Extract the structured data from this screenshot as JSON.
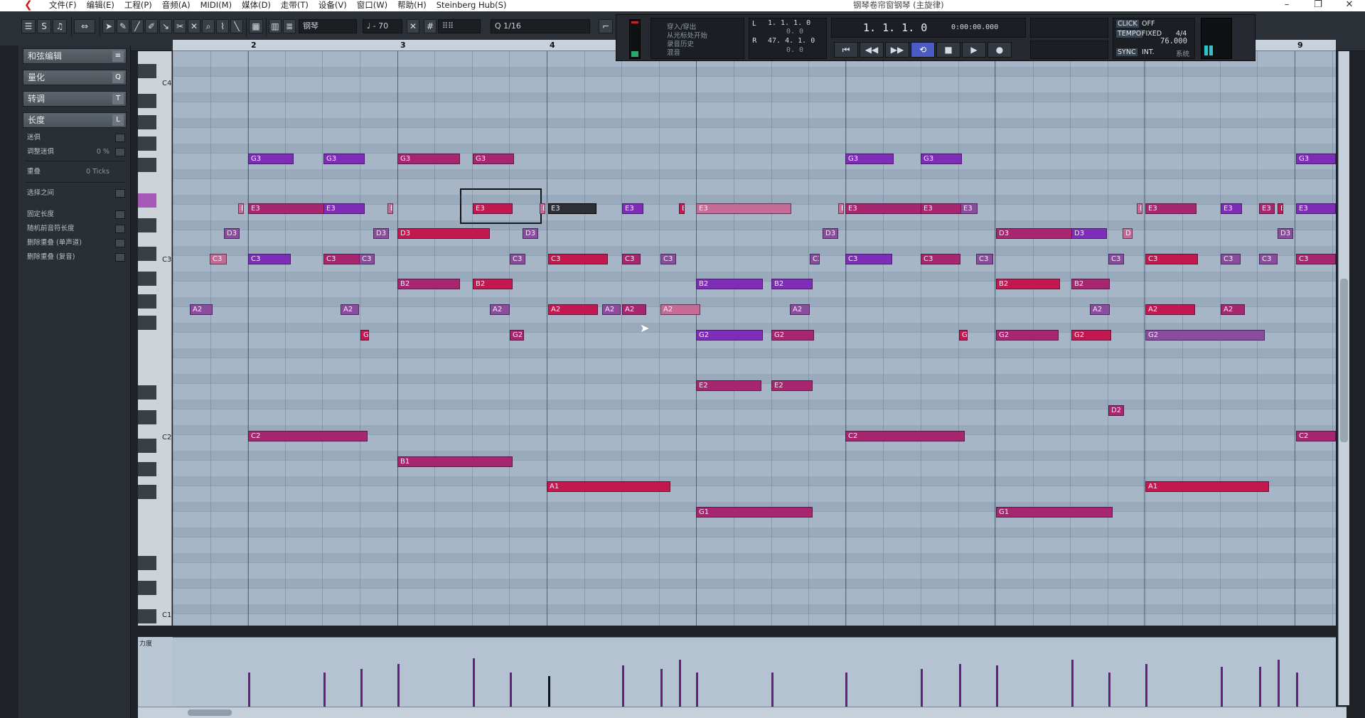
{
  "window": {
    "title": "钢琴卷帘窗钢琴 (主旋律)",
    "menus": [
      "文件(F)",
      "编辑(E)",
      "工程(P)",
      "音频(A)",
      "MIDI(M)",
      "媒体(D)",
      "走带(T)",
      "设备(V)",
      "窗口(W)",
      "帮助(H)",
      "Steinberg Hub(S)"
    ],
    "controls": [
      "–",
      "❐",
      "✕"
    ]
  },
  "toolbar": {
    "track_name": "钢琴",
    "velocity": "70",
    "quantize": "1/16",
    "length_label": "1/16"
  },
  "transport": {
    "panel_items": [
      "穿入/穿出",
      "从光标处开始",
      "录音历史",
      "混音"
    ],
    "locators": {
      "left": "1. 1. 1.   0",
      "left2": "0.   0",
      "right": "47. 4. 1.   0",
      "right2": "0.   0"
    },
    "position_primary": "1. 1. 1.   0",
    "position_secondary": "0:00:00.000",
    "click": "CLICK",
    "click_state": "OFF",
    "tempo_label": "TEMPO",
    "tempo_mode": "FIXED",
    "signature": "4/4",
    "tempo": "76.000",
    "sync": "SYNC",
    "sync_mode": "INT.",
    "sync_state": "系统"
  },
  "inspector": {
    "sections": [
      {
        "label": "和弦编辑",
        "icon": "≡"
      },
      {
        "label": "量化",
        "icon": "Q"
      },
      {
        "label": "转调",
        "icon": "T"
      },
      {
        "label": "长度",
        "icon": "L"
      }
    ],
    "rows": [
      {
        "label": "迷俱",
        "value": ""
      },
      {
        "label": "调整迷俱",
        "value": "0 %"
      },
      {
        "label": "重叠",
        "value": "0 Ticks"
      },
      {
        "label": "选择之间",
        "value": ""
      },
      {
        "label": "固定长度",
        "value": ""
      },
      {
        "label": "随机前音符长度",
        "value": ""
      },
      {
        "label": "删除重叠 (单声道)",
        "value": ""
      },
      {
        "label": "删除重叠 (复音)",
        "value": ""
      }
    ]
  },
  "keyboard": {
    "labels": [
      "C4",
      "C3",
      "C2",
      "C1"
    ]
  },
  "ruler": {
    "bars": [
      "2",
      "3",
      "4",
      "9"
    ]
  },
  "velocity_lane": {
    "label": "力度"
  },
  "notes": [
    {
      "text": "G3",
      "color": "purple"
    },
    {
      "text": "G3",
      "color": "purple"
    },
    {
      "text": "G3",
      "color": "magenta"
    },
    {
      "text": "G3",
      "color": "magenta"
    },
    {
      "text": "G3",
      "color": "purple"
    },
    {
      "text": "G3",
      "color": "purple"
    },
    {
      "text": "G3",
      "color": "purple"
    },
    {
      "text": "E",
      "color": "pink"
    },
    {
      "text": "E3",
      "color": "magenta"
    },
    {
      "text": "E3",
      "color": "purple"
    },
    {
      "text": "E",
      "color": "pink"
    },
    {
      "text": "E3",
      "color": "red"
    },
    {
      "text": "E",
      "color": "pink"
    },
    {
      "text": "E3",
      "color": "selected"
    },
    {
      "text": "E3",
      "color": "purple"
    },
    {
      "text": "E",
      "color": "red"
    },
    {
      "text": "E3",
      "color": "pink"
    },
    {
      "text": "E",
      "color": "pink"
    },
    {
      "text": "E3",
      "color": "magenta"
    },
    {
      "text": "E3",
      "color": "magenta"
    },
    {
      "text": "E3",
      "color": "violet"
    },
    {
      "text": "E",
      "color": "pink"
    },
    {
      "text": "E3",
      "color": "magenta"
    },
    {
      "text": "E3",
      "color": "purple"
    },
    {
      "text": "E3",
      "color": "magenta"
    },
    {
      "text": "E",
      "color": "red"
    },
    {
      "text": "E3",
      "color": "purple"
    },
    {
      "text": "D3",
      "color": "violet"
    },
    {
      "text": "D3",
      "color": "violet"
    },
    {
      "text": "D3",
      "color": "red"
    },
    {
      "text": "D3",
      "color": "violet"
    },
    {
      "text": "D3",
      "color": "violet"
    },
    {
      "text": "D3",
      "color": "magenta"
    },
    {
      "text": "D3",
      "color": "purple"
    },
    {
      "text": "D",
      "color": "pink"
    },
    {
      "text": "D3",
      "color": "violet"
    },
    {
      "text": "C3",
      "color": "pink"
    },
    {
      "text": "C3",
      "color": "purple"
    },
    {
      "text": "C3",
      "color": "magenta"
    },
    {
      "text": "C3",
      "color": "violet"
    },
    {
      "text": "C3",
      "color": "violet"
    },
    {
      "text": "C3",
      "color": "red"
    },
    {
      "text": "C3",
      "color": "magenta"
    },
    {
      "text": "C3",
      "color": "violet"
    },
    {
      "text": "C3",
      "color": "violet"
    },
    {
      "text": "C3",
      "color": "purple"
    },
    {
      "text": "C3",
      "color": "magenta"
    },
    {
      "text": "C3",
      "color": "violet"
    },
    {
      "text": "C3",
      "color": "violet"
    },
    {
      "text": "C3",
      "color": "red"
    },
    {
      "text": "C3",
      "color": "violet"
    },
    {
      "text": "C3",
      "color": "violet"
    },
    {
      "text": "C3",
      "color": "magenta"
    },
    {
      "text": "B2",
      "color": "magenta"
    },
    {
      "text": "B2",
      "color": "red"
    },
    {
      "text": "B2",
      "color": "purple"
    },
    {
      "text": "B2",
      "color": "purple"
    },
    {
      "text": "B2",
      "color": "red"
    },
    {
      "text": "B2",
      "color": "magenta"
    },
    {
      "text": "A2",
      "color": "violet"
    },
    {
      "text": "A2",
      "color": "violet"
    },
    {
      "text": "A2",
      "color": "violet"
    },
    {
      "text": "A2",
      "color": "red"
    },
    {
      "text": "A2",
      "color": "violet"
    },
    {
      "text": "A2",
      "color": "magenta"
    },
    {
      "text": "A2",
      "color": "pink"
    },
    {
      "text": "A2",
      "color": "violet"
    },
    {
      "text": "A2",
      "color": "violet"
    },
    {
      "text": "A2",
      "color": "red"
    },
    {
      "text": "A2",
      "color": "magenta"
    },
    {
      "text": "G",
      "color": "red"
    },
    {
      "text": "G2",
      "color": "magenta"
    },
    {
      "text": "G2",
      "color": "purple"
    },
    {
      "text": "G2",
      "color": "magenta"
    },
    {
      "text": "G",
      "color": "red"
    },
    {
      "text": "G2",
      "color": "magenta"
    },
    {
      "text": "G2",
      "color": "red"
    },
    {
      "text": "G2",
      "color": "violet"
    },
    {
      "text": "E2",
      "color": "magenta"
    },
    {
      "text": "E2",
      "color": "magenta"
    },
    {
      "text": "D2",
      "color": "magenta"
    },
    {
      "text": "C2",
      "color": "magenta"
    },
    {
      "text": "C2",
      "color": "magenta"
    },
    {
      "text": "C2",
      "color": "magenta"
    },
    {
      "text": "B1",
      "color": "magenta"
    },
    {
      "text": "A1",
      "color": "red"
    },
    {
      "text": "A1",
      "color": "red"
    },
    {
      "text": "G1",
      "color": "magenta"
    },
    {
      "text": "G1",
      "color": "magenta"
    }
  ],
  "colors": {
    "purple": "#7f2cb8",
    "magenta": "#a8266f",
    "red": "#c3174f",
    "pink": "#c56b95",
    "violet": "#8a4d9e",
    "selected": "#2c2f33",
    "grid_bg": "#a6b6c7",
    "transport_active": "#4b5cc5"
  }
}
